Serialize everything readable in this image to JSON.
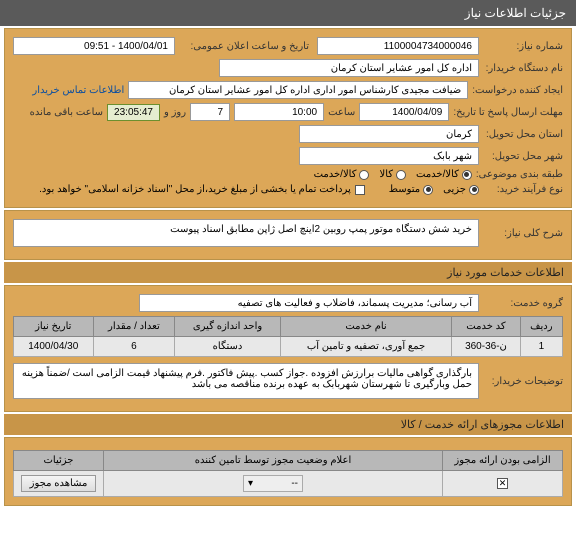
{
  "header": {
    "title": "جزئیات اطلاعات نیاز"
  },
  "form": {
    "need_number_label": "شماره نیاز:",
    "need_number": "1100004734000046",
    "public_announce_label": "تاریخ و ساعت اعلان عمومی:",
    "public_announce": "1400/04/01 - 09:51",
    "buyer_org_label": "نام دستگاه خریدار:",
    "buyer_org": "اداره کل امور عشایر استان کرمان",
    "creator_label": "ایجاد کننده درخواست:",
    "creator": "ضیافت مجیدی کارشناس امور اداری اداره کل امور عشایر استان کرمان",
    "contact_link": "اطلاعات تماس خریدار",
    "deadline_label": "مهلت ارسال پاسخ تا تاریخ:",
    "deadline_date": "1400/04/09",
    "time_label": "ساعت",
    "deadline_time": "10:00",
    "days_count": "7",
    "days_label": "روز و",
    "remaining_time": "23:05:47",
    "remaining_label": "ساعت باقی مانده",
    "state_label": "استان محل تحویل:",
    "state": "کرمان",
    "city_label": "شهر محل تحویل:",
    "city": "شهر بابک",
    "category_label": "طبقه بندی موضوعی:",
    "cat_options": {
      "service": "کالا/خدمت",
      "goods": "کالا",
      "both": "کالا/خدمت"
    },
    "purchase_process_label": "نوع فرآیند خرید:",
    "proc_options": {
      "partial": "جزیی",
      "medium": "متوسط"
    },
    "payment_note": "پرداخت تمام یا بخشی از مبلغ خرید،از محل \"اسناد خزانه اسلامی\" خواهد بود."
  },
  "desc": {
    "label": "شرح کلی نیاز:",
    "text": "خرید شش دستگاه موتور پمپ روبین 2اینچ اصل ژاپن مطابق اسناد پیوست"
  },
  "services_header": "اطلاعات خدمات مورد نیاز",
  "service_group": {
    "label": "گروه خدمت:",
    "value": "آب رسانی؛ مدیریت پسماند، فاضلاب و فعالیت های تصفیه"
  },
  "table": {
    "headers": [
      "ردیف",
      "کد خدمت",
      "نام خدمت",
      "واحد اندازه گیری",
      "تعداد / مقدار",
      "تاریخ نیاز"
    ],
    "row1": {
      "idx": "1",
      "code": "ن-36-360",
      "name": "جمع آوری، تصفیه و تامین آب",
      "unit": "دستگاه",
      "qty": "6",
      "date": "1400/04/30"
    }
  },
  "buyer_notes": {
    "label": "توضیحات خریدار:",
    "text": "بارگذاری گواهی مالیات برارزش افزوده .جواز کسب .پیش فاکتور .فرم پیشنهاد قیمت الزامی است /ضمناً هزینه حمل وبارگیری تا شهرستان شهربابک به عهده برنده مناقصه می باشد"
  },
  "permits_header": "اطلاعات مجوزهای ارائه خدمت / کالا",
  "permits_table": {
    "headers": [
      "الزامی بودن ارائه مجوز",
      "اعلام وضعیت مجوز توسط تامین کننده",
      "جزئیات"
    ],
    "select_placeholder": "--",
    "view_btn": "مشاهده مجوز"
  }
}
